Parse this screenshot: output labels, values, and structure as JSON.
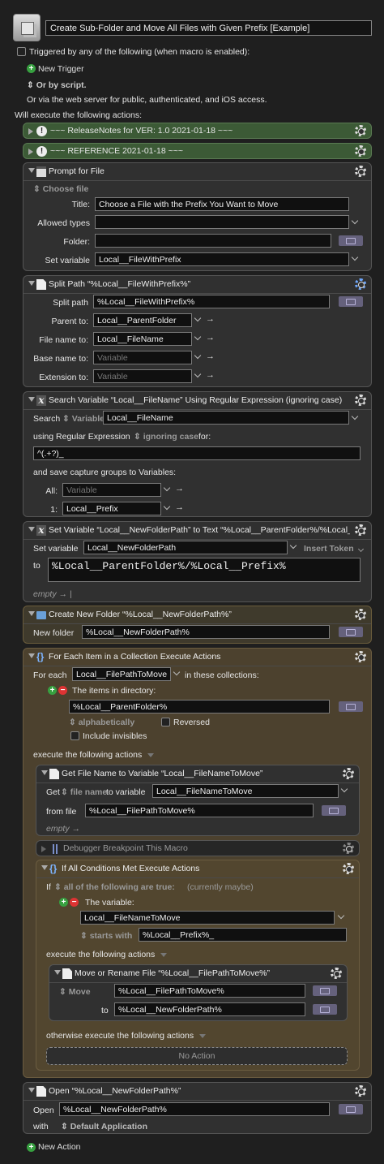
{
  "macro": {
    "title": "Create Sub-Folder and Move All Files with Given Prefix [Example]",
    "triggered_text": "Triggered by any of the following (when macro is enabled):",
    "new_trigger": "New Trigger",
    "or_script": "Or by script.",
    "web_server": "Or via the web server for public, authenticated, and iOS access.",
    "will_execute": "Will execute the following actions:",
    "new_action": "New Action"
  },
  "a_release": {
    "title": "~~~ ReleaseNotes for  VER: 1.0    2021-01-18 ~~~"
  },
  "a_reference": {
    "title": "~~~ REFERENCE  2021-01-18 ~~~"
  },
  "a_prompt": {
    "title": "Prompt for File",
    "choose": "Choose file",
    "title_label": "Title:",
    "title_value": "Choose a File with the Prefix You Want to Move",
    "types_label": "Allowed types",
    "folder_label": "Folder:",
    "setvar_label": "Set variable",
    "setvar_value": "Local__FileWithPrefix"
  },
  "a_split": {
    "title": "Split Path “%Local__FileWithPrefix%”",
    "path_label": "Split path",
    "path_value": "%Local__FileWithPrefix%",
    "parent_label": "Parent to:",
    "parent_value": "Local__ParentFolder",
    "filename_label": "File name to:",
    "filename_value": "Local__FileName",
    "base_label": "Base name to:",
    "base_ph": "Variable",
    "ext_label": "Extension to:",
    "ext_ph": "Variable"
  },
  "a_search": {
    "title": "Search Variable “Local__FileName” Using Regular Expression (ignoring case)",
    "search_label": "Search",
    "var_label": "Variable",
    "var_value": "Local__FileName",
    "using_label": "using Regular Expression",
    "case_label": "ignoring case",
    "for_label": "for:",
    "regex": "^(.+?)_",
    "save_label": "and save capture groups to Variables:",
    "all_label": "All:",
    "all_ph": "Variable",
    "g1_label": "1:",
    "g1_value": "Local__Prefix"
  },
  "a_setvar": {
    "title": "Set Variable “Local__NewFolderPath” to Text “%Local__ParentFolder%/%Local_...",
    "setvar_label": "Set variable",
    "setvar_value": "Local__NewFolderPath",
    "insert_token": "Insert Token",
    "to_label": "to",
    "text": "%Local__ParentFolder%/%Local__Prefix%",
    "empty": "empty"
  },
  "a_newfolder": {
    "title": "Create New Folder “%Local__NewFolderPath%”",
    "label": "New folder",
    "value": "%Local__NewFolderPath%"
  },
  "a_foreach": {
    "title": "For Each Item in a Collection Execute Actions",
    "for_each_label": "For each",
    "var_value": "Local__FilePathToMove",
    "in_label": "in these collections:",
    "items_label": "The items in directory:",
    "dir_value": "%Local__ParentFolder%",
    "sort": "alphabetically",
    "reversed": "Reversed",
    "invisibles": "Include invisibles",
    "execute": "execute the following actions"
  },
  "a_getname": {
    "title": "Get File Name to Variable “Local__FileNameToMove”",
    "get_label": "Get",
    "file_name": "file name",
    "to_var": "to variable",
    "var_value": "Local__FileNameToMove",
    "from_label": "from file",
    "from_value": "%Local__FilePathToMove%",
    "empty": "empty"
  },
  "a_debug": {
    "title": "Debugger Breakpoint This Macro"
  },
  "a_ifall": {
    "title": "If All Conditions Met Execute Actions",
    "if_label": "If",
    "cond": "all of the following are true:",
    "status": "(currently maybe)",
    "variable_label": "The variable:",
    "var_value": "Local__FileNameToMove",
    "op": "starts with",
    "op_value": "%Local__Prefix%_",
    "execute": "execute the following actions",
    "otherwise": "otherwise execute the following actions",
    "no_action": "No Action"
  },
  "a_move": {
    "title": "Move or Rename File “%Local__FilePathToMove%”",
    "move_label": "Move",
    "move_value": "%Local__FilePathToMove%",
    "to_label": "to",
    "to_value": "%Local__NewFolderPath%"
  },
  "a_open": {
    "title": "Open “%Local__NewFolderPath%”",
    "open_label": "Open",
    "open_value": "%Local__NewFolderPath%",
    "with_label": "with",
    "with_value": "Default Application"
  }
}
